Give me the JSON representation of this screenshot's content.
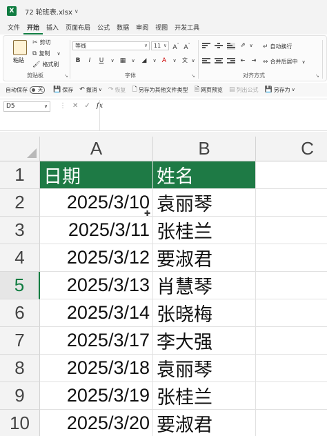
{
  "titlebar": {
    "app_icon": "X",
    "filename": "72 轮班表.xlsx"
  },
  "menu": {
    "tabs": [
      "文件",
      "开始",
      "插入",
      "页面布局",
      "公式",
      "数据",
      "审阅",
      "视图",
      "开发工具"
    ],
    "active": "开始"
  },
  "ribbon": {
    "clipboard": {
      "paste": "粘贴",
      "cut": "剪切",
      "copy": "复制",
      "format_painter": "格式刷",
      "group": "剪贴板"
    },
    "font": {
      "name": "等线",
      "size": "11",
      "grow": "A",
      "shrink": "A",
      "bold": "B",
      "italic": "I",
      "underline": "U",
      "color_a": "A",
      "group": "字体"
    },
    "alignment": {
      "wrap": "自动换行",
      "merge": "合并后居中",
      "group": "对齐方式"
    }
  },
  "qat": {
    "autosave": "自动保存",
    "autosave_state": "关",
    "save": "保存",
    "undo": "撤消",
    "redo": "恢复",
    "save_as_other": "另存为其他文件类型",
    "web_preview": "网页预览",
    "list_formula": "列出公式",
    "save_as": "另存为"
  },
  "formula_bar": {
    "cell_ref": "D5",
    "fx": "fx",
    "value": ""
  },
  "sheet": {
    "columns": [
      "A",
      "B",
      "C"
    ],
    "rows": [
      "1",
      "2",
      "3",
      "4",
      "5",
      "6",
      "7",
      "8",
      "9",
      "10"
    ],
    "selected_row": "5",
    "header": {
      "a": "日期",
      "b": "姓名"
    },
    "data": [
      {
        "a": "2025/3/10",
        "b": "袁丽琴"
      },
      {
        "a": "2025/3/11",
        "b": "张桂兰"
      },
      {
        "a": "2025/3/12",
        "b": "要淑君"
      },
      {
        "a": "2025/3/13",
        "b": "肖慧琴"
      },
      {
        "a": "2025/3/14",
        "b": "张晓梅"
      },
      {
        "a": "2025/3/17",
        "b": "李大强"
      },
      {
        "a": "2025/3/18",
        "b": "袁丽琴"
      },
      {
        "a": "2025/3/19",
        "b": "张桂兰"
      },
      {
        "a": "2025/3/20",
        "b": "要淑君"
      }
    ]
  },
  "colors": {
    "accent": "#107c41",
    "header_fill": "#1e7a45"
  }
}
